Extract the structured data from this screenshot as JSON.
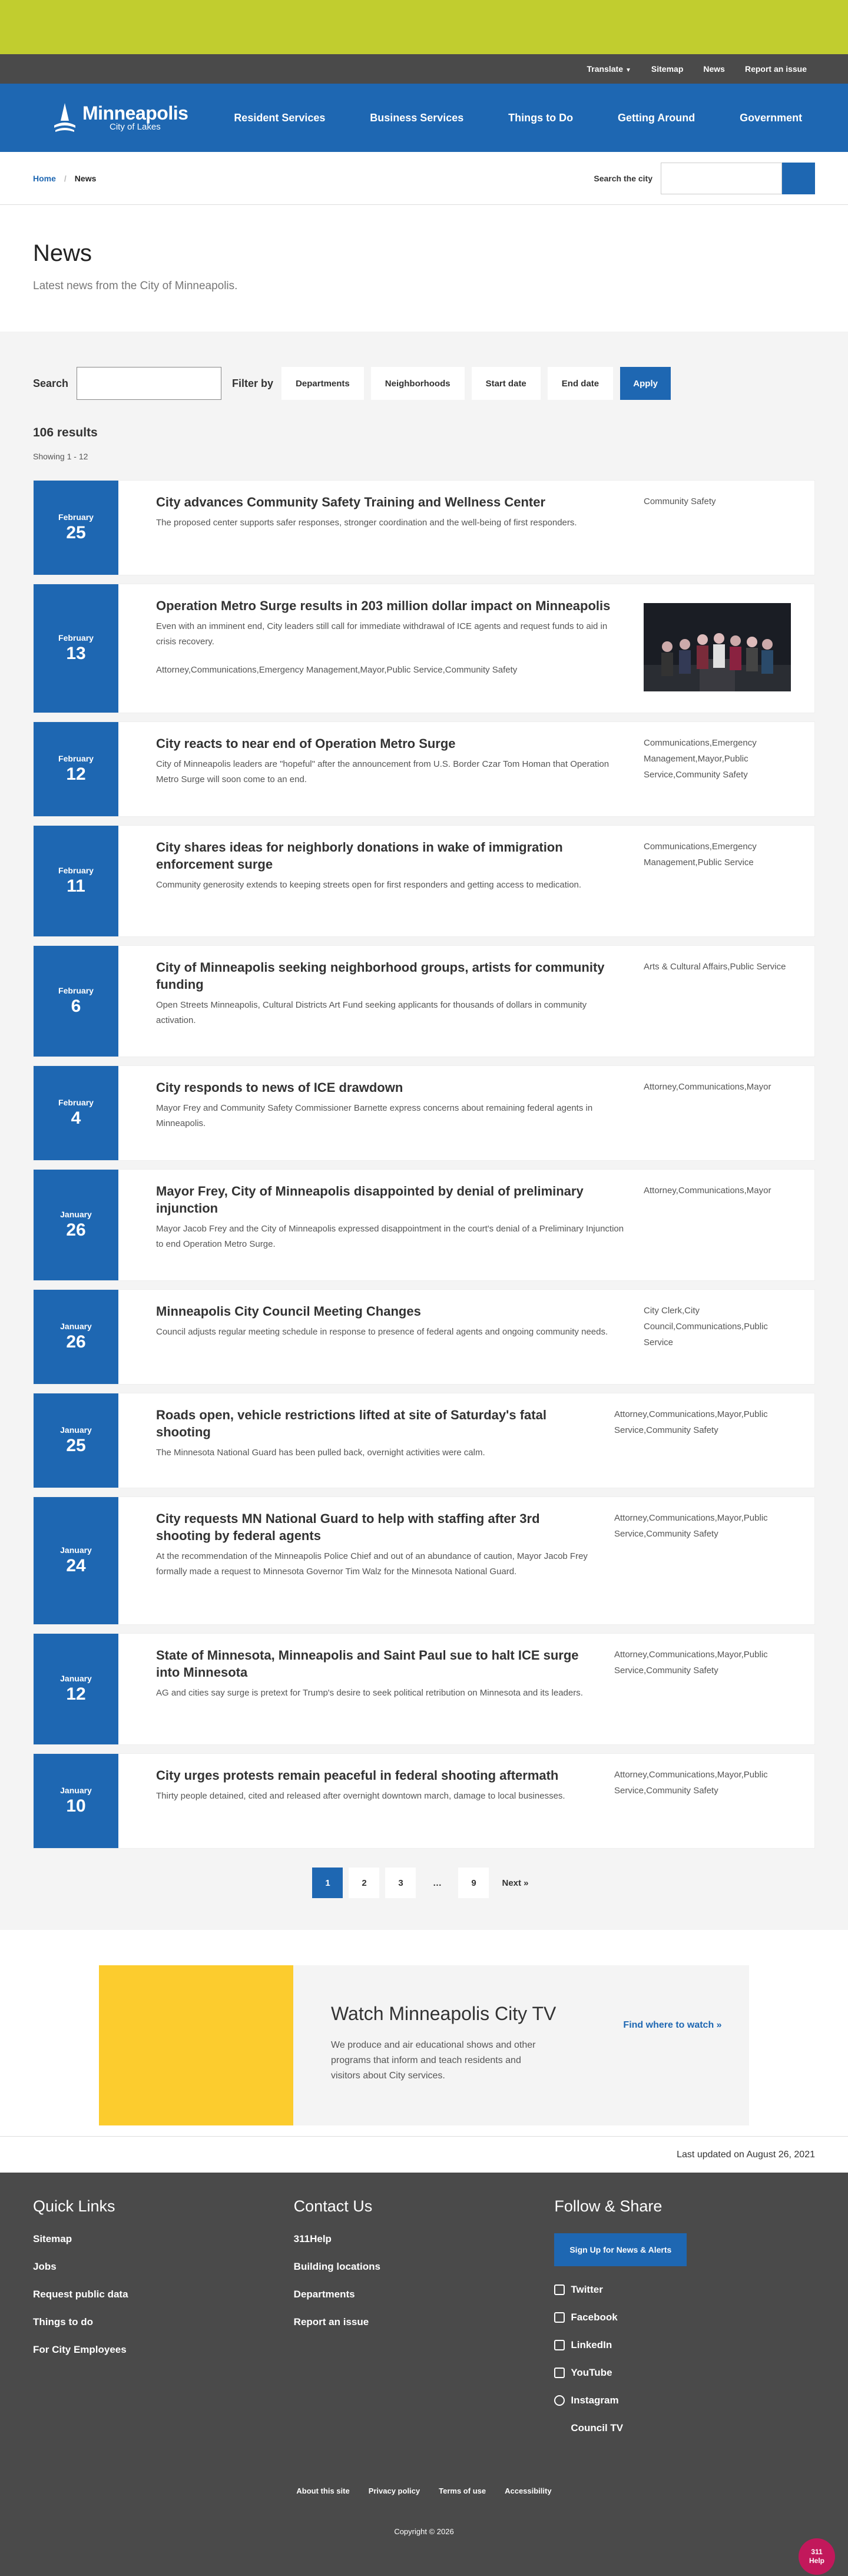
{
  "util": {
    "translate": "Translate",
    "sitemap": "Sitemap",
    "news": "News",
    "report": "Report an issue"
  },
  "header": {
    "logo_name": "Minneapolis",
    "logo_sub": "City of Lakes",
    "nav": [
      "Resident Services",
      "Business Services",
      "Things to Do",
      "Getting Around",
      "Government"
    ]
  },
  "breadcrumb": {
    "home": "Home",
    "current": "News"
  },
  "site_search": {
    "label": "Search the city"
  },
  "page": {
    "title": "News",
    "subtitle": "Latest news from the City of Minneapolis."
  },
  "filters": {
    "search_label": "Search",
    "filter_label": "Filter by",
    "departments": "Departments",
    "neighborhoods": "Neighborhoods",
    "start_date": "Start date",
    "end_date": "End date",
    "apply": "Apply"
  },
  "results": {
    "count": "106 results",
    "showing": "Showing 1 - 12"
  },
  "articles": [
    {
      "month": "February",
      "day": "25",
      "title": "City advances Community Safety Training and Wellness Center",
      "summary": "The proposed center supports safer responses, stronger coordination and the well-being of first responders.",
      "tags": "Community Safety"
    },
    {
      "month": "February",
      "day": "13",
      "title": "Operation Metro Surge results in 203 million dollar impact on Minneapolis",
      "summary": "Even with an imminent end, City leaders still call for immediate withdrawal of ICE agents and request funds to aid in crisis recovery.",
      "tags": "Attorney,Communications,Emergency Management,Mayor,Public Service,Community Safety"
    },
    {
      "month": "February",
      "day": "12",
      "title": "City reacts to near end of Operation Metro Surge",
      "summary": "City of Minneapolis leaders are \"hopeful\" after the announcement from U.S. Border Czar Tom Homan that Operation Metro Surge will soon come to an end.",
      "tags": "Communications,Emergency Management,Mayor,Public Service,Community Safety"
    },
    {
      "month": "February",
      "day": "11",
      "title": "City shares ideas for neighborly donations in wake of immigration enforcement surge",
      "summary": "Community generosity extends to keeping streets open for first responders and getting access to medication.",
      "tags": "Communications,Emergency Management,Public Service"
    },
    {
      "month": "February",
      "day": "6",
      "title": "City of Minneapolis seeking neighborhood groups, artists for community funding",
      "summary": "Open Streets Minneapolis, Cultural Districts Art Fund seeking applicants for thousands of dollars in community activation.",
      "tags": "Arts & Cultural Affairs,Public Service"
    },
    {
      "month": "February",
      "day": "4",
      "title": "City responds to news of ICE drawdown",
      "summary": "Mayor Frey and Community Safety Commissioner Barnette express concerns about remaining federal agents in Minneapolis.",
      "tags": "Attorney,Communications,Mayor"
    },
    {
      "month": "January",
      "day": "26",
      "title": "Mayor Frey, City of Minneapolis disappointed by denial of preliminary injunction",
      "summary": "Mayor Jacob Frey and the City of Minneapolis expressed disappointment in the court's denial of a Preliminary Injunction to end Operation Metro Surge.",
      "tags": "Attorney,Communications,Mayor"
    },
    {
      "month": "January",
      "day": "26",
      "title": "Minneapolis City Council Meeting Changes",
      "summary": "Council adjusts regular meeting schedule in response to presence of federal agents and ongoing community needs.",
      "tags": "City Clerk,City Council,Communications,Public Service"
    },
    {
      "month": "January",
      "day": "25",
      "title": "Roads open, vehicle restrictions lifted at site of Saturday's fatal shooting",
      "summary": "The Minnesota National Guard has been pulled back, overnight activities were calm.",
      "tags": "Attorney,Communications,Mayor,Public Service,Community Safety"
    },
    {
      "month": "January",
      "day": "24",
      "title": "City requests MN National Guard to help with staffing after 3rd shooting by federal agents",
      "summary": "At the recommendation of the Minneapolis Police Chief and out of an abundance of caution, Mayor Jacob Frey formally made a request to Minnesota Governor Tim Walz for the Minnesota National Guard.",
      "tags": "Attorney,Communications,Mayor,Public Service,Community Safety"
    },
    {
      "month": "January",
      "day": "12",
      "title": "State of Minnesota, Minneapolis and Saint Paul sue to halt ICE surge into Minnesota",
      "summary": "AG and cities say surge is pretext for Trump's desire to seek political retribution on Minnesota and its leaders.",
      "tags": "Attorney,Communications,Mayor,Public Service,Community Safety"
    },
    {
      "month": "January",
      "day": "10",
      "title": "City urges protests remain peaceful in federal shooting aftermath",
      "summary": "Thirty people detained, cited and released after overnight downtown march, damage to local businesses.",
      "tags": "Attorney,Communications,Mayor,Public Service,Community Safety"
    }
  ],
  "pager": {
    "p1": "1",
    "p2": "2",
    "p3": "3",
    "dots": "…",
    "p9": "9",
    "next": "Next »"
  },
  "promo": {
    "title": "Watch Minneapolis City TV",
    "text": "We produce and air educational shows and other programs that inform and teach residents and visitors about City services.",
    "link": "Find where to watch »"
  },
  "updated": "Last updated on August 26, 2021",
  "footer": {
    "quick_title": "Quick Links",
    "quick": [
      "Sitemap",
      "Jobs",
      "Request public data",
      "Things to do",
      "For City Employees"
    ],
    "contact_title": "Contact Us",
    "contact": [
      "311Help",
      "Building locations",
      "Departments",
      "Report an issue"
    ],
    "follow_title": "Follow & Share",
    "signup": "Sign Up for News & Alerts",
    "social": [
      "Twitter",
      "Facebook",
      "LinkedIn",
      "YouTube",
      "Instagram",
      "Council TV"
    ],
    "legal": [
      "About this site",
      "Privacy policy",
      "Terms of use",
      "Accessibility"
    ],
    "copyright": "Copyright © 2026",
    "help_num": "311",
    "help_label": "Help"
  }
}
